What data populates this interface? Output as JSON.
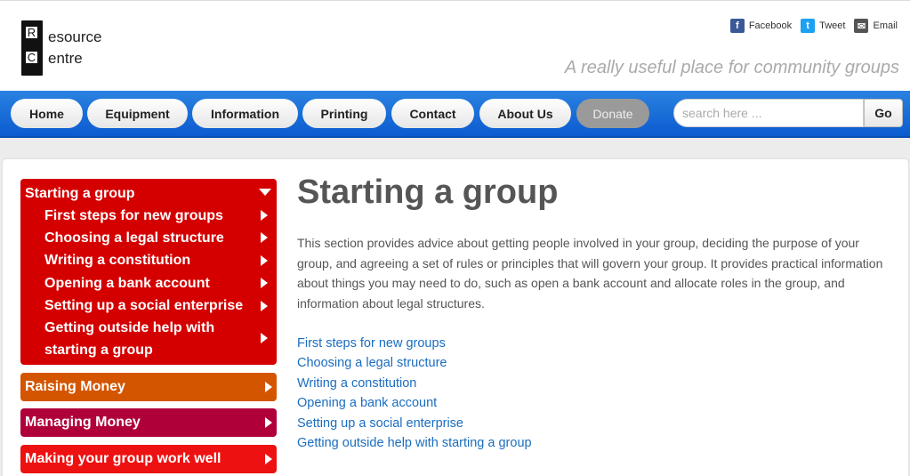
{
  "logo": {
    "letter1": "R",
    "letter2": "C",
    "word1": "esource",
    "word2": "entre"
  },
  "social": {
    "facebook": "Facebook",
    "tweet": "Tweet",
    "email": "Email",
    "facebook_glyph": "f",
    "tweet_glyph": "t",
    "email_glyph": "✉"
  },
  "tagline": "A really useful place for community groups",
  "nav": {
    "items": [
      "Home",
      "Equipment",
      "Information",
      "Printing",
      "Contact",
      "About Us",
      "Donate"
    ],
    "search_placeholder": "search here ...",
    "go": "Go"
  },
  "sidebar": {
    "active_section": "Starting a group",
    "sub_items": [
      "First steps for new groups",
      "Choosing a legal structure",
      "Writing a constitution",
      "Opening a bank account",
      "Setting up a social enterprise",
      "Getting outside help with",
      "starting a group"
    ],
    "sections": [
      {
        "label": "Raising Money",
        "color": "#d45500"
      },
      {
        "label": "Managing Money",
        "color": "#b0003a"
      },
      {
        "label": "Making your group work well",
        "color": "#ee1111"
      }
    ],
    "active_color": "#d40000"
  },
  "main": {
    "title": "Starting a group",
    "intro": "This section provides advice about getting people involved in your group, deciding the purpose of your group, and agreeing a set of rules or principles that will govern your group. It provides practical information about things you may need to do, such as open a bank account and allocate roles in the group, and information about legal structures.",
    "links": [
      "First steps for new groups",
      "Choosing a legal structure",
      "Writing a constitution",
      "Opening a bank account",
      "Setting up a social enterprise",
      "Getting outside help with starting a group"
    ]
  }
}
